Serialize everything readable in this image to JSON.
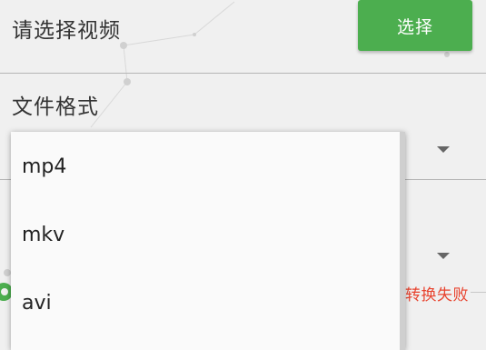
{
  "video_row": {
    "label": "请选择视频",
    "select_button": "选择"
  },
  "format_row": {
    "label": "文件格式"
  },
  "format_dropdown": {
    "options": [
      "mp4",
      "mkv",
      "avi"
    ]
  },
  "status": {
    "text": "转换失败"
  },
  "colors": {
    "accent": "#4cae4f",
    "error": "#e8442f",
    "background": "#f0f0f0"
  }
}
